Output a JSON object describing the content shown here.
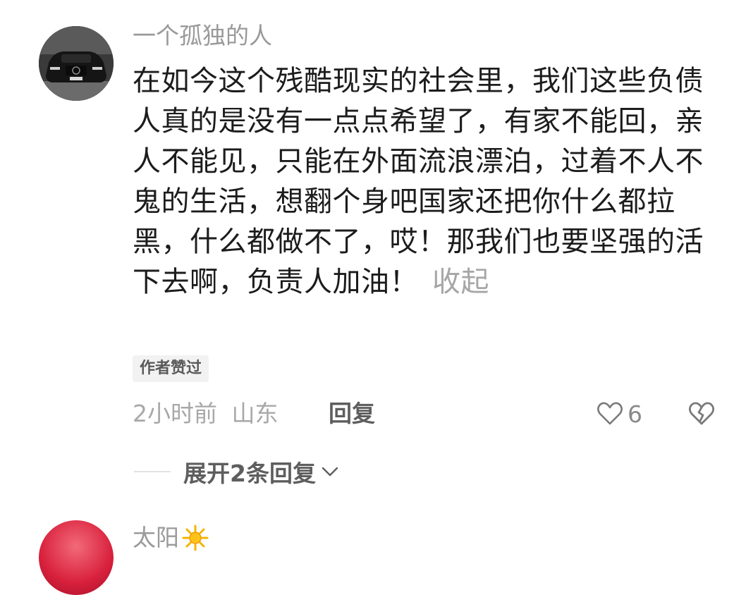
{
  "comment1": {
    "username": "一个孤独的人",
    "text": "在如今这个残酷现实的社会里，我们这些负债人真的是没有一点点希望了，有家不能回，亲人不能见，只能在外面流浪漂泊，过着不人不鬼的生活，想翻个身吧国家还把你什么都拉黑，什么都做不了，哎！那我们也要坚强的活下去啊，负责人加油！",
    "collapse_label": "收起",
    "author_liked_badge": "作者赞过",
    "time": "2小时前",
    "location": "山东",
    "reply_label": "回复",
    "like_count": "6",
    "avatar_icon": "car-avatar",
    "like_icon": "heart-outline-icon",
    "dislike_icon": "broken-heart-icon"
  },
  "expand": {
    "label": "展开2条回复",
    "icon": "chevron-down-icon"
  },
  "comment2": {
    "username": "太阳",
    "badge_icon": "sun-icon"
  },
  "colors": {
    "primary_text": "#1c1c1c",
    "secondary_text": "#9a9a9a",
    "action_text": "#5e5e5e"
  }
}
